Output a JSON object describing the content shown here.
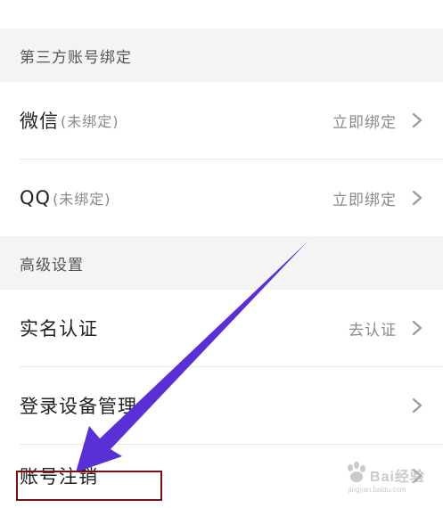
{
  "sections": {
    "third_party": {
      "header": "第三方账号绑定"
    },
    "advanced": {
      "header": "高级设置"
    }
  },
  "rows": {
    "wechat": {
      "title": "微信",
      "status": "(未绑定)",
      "action": "立即绑定"
    },
    "qq": {
      "title": "QQ",
      "status": "(未绑定)",
      "action": "立即绑定"
    },
    "realname": {
      "title": "实名认证",
      "action": "去认证"
    },
    "device": {
      "title": "登录设备管理"
    },
    "cancel": {
      "title": "账号注销"
    }
  },
  "annotation": {
    "arrow_color": "#5a2fd6",
    "box_color": "#7a1010"
  },
  "watermark": {
    "text": "Bai经验",
    "url": "jingyan.baidu.com"
  },
  "colors": {
    "section_bg": "#f4f4f4",
    "secondary_text": "#8a8a8a",
    "chevron": "#9a9a9a"
  },
  "icons": {
    "chevron": "chevron-right-icon",
    "watermark": "paw-icon"
  }
}
